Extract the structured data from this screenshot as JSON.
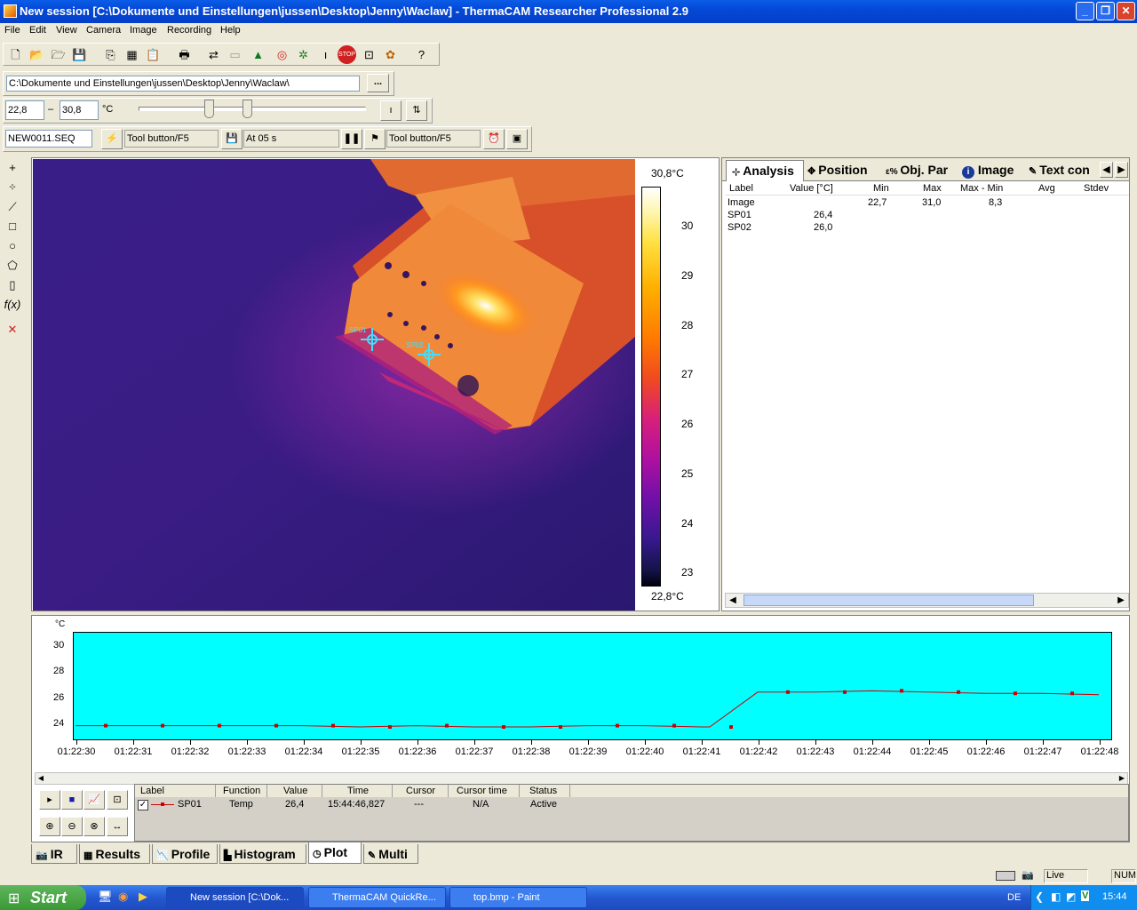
{
  "window": {
    "title": "New session [C:\\Dokumente und Einstellungen\\jussen\\Desktop\\Jenny\\Waclaw] - ThermaCAM Researcher Professional 2.9"
  },
  "menu": [
    "File",
    "Edit",
    "View",
    "Camera",
    "Image",
    "Recording",
    "Help"
  ],
  "path_field": "C:\\Dokumente und Einstellungen\\jussen\\Desktop\\Jenny\\Waclaw\\",
  "browse_label": "...",
  "range": {
    "min": "22,8",
    "dash": "–",
    "max": "30,8",
    "unit": "°C"
  },
  "seq_row": {
    "file": "NEW0011.SEQ",
    "tool1": "Tool button/F5",
    "at": "At 05 s",
    "tool2": "Tool button/F5"
  },
  "ir": {
    "spot_labels": [
      "SP01",
      "SP02"
    ],
    "scale_top": "30,8°C",
    "scale_bottom": "22,8°C",
    "scale_ticks": [
      "30",
      "29",
      "28",
      "27",
      "26",
      "25",
      "24",
      "23"
    ]
  },
  "analysis": {
    "tabs": [
      "Analysis",
      "Position",
      "Obj. Par",
      "Image",
      "Text con"
    ],
    "columns": [
      "Label",
      "Value [°C]",
      "Min",
      "Max",
      "Max - Min",
      "Avg",
      "Stdev"
    ],
    "rows": [
      {
        "label": "Image",
        "value": "",
        "min": "22,7",
        "max": "31,0",
        "maxmin": "8,3"
      },
      {
        "label": "SP01",
        "value": "26,4",
        "min": "",
        "max": "",
        "maxmin": ""
      },
      {
        "label": "SP02",
        "value": "26,0",
        "min": "",
        "max": "",
        "maxmin": ""
      }
    ]
  },
  "plot": {
    "unit": "°C",
    "yticks": [
      "30",
      "28",
      "26",
      "24"
    ],
    "xticks": [
      "01:22:30",
      "01:22:31",
      "01:22:32",
      "01:22:33",
      "01:22:34",
      "01:22:35",
      "01:22:36",
      "01:22:37",
      "01:22:38",
      "01:22:39",
      "01:22:40",
      "01:22:41",
      "01:22:42",
      "01:22:43",
      "01:22:44",
      "01:22:45",
      "01:22:46",
      "01:22:47",
      "01:22:48"
    ],
    "columns": [
      "Label",
      "Function",
      "Value",
      "Time",
      "Cursor",
      "Cursor time",
      "Status"
    ],
    "row": {
      "label": "SP01",
      "function": "Temp",
      "value": "26,4",
      "time": "15:44:46,827",
      "cursor": "---",
      "cursor_time": "N/A",
      "status": "Active"
    },
    "bg_color": "#00ffff",
    "line_color": "#cc0000"
  },
  "chart_data": {
    "type": "line",
    "title": "",
    "xlabel": "",
    "ylabel": "°C",
    "ylim": [
      22.8,
      31.0
    ],
    "x": [
      "01:22:30",
      "01:22:31",
      "01:22:32",
      "01:22:33",
      "01:22:34",
      "01:22:35",
      "01:22:36",
      "01:22:37",
      "01:22:38",
      "01:22:39",
      "01:22:40",
      "01:22:41",
      "01:22:42",
      "01:22:43",
      "01:22:44",
      "01:22:45",
      "01:22:46",
      "01:22:47",
      "01:22:48"
    ],
    "series": [
      {
        "name": "SP01",
        "values": [
          24.0,
          24.0,
          24.0,
          24.0,
          24.0,
          23.9,
          24.0,
          23.9,
          23.9,
          24.0,
          24.0,
          23.9,
          26.6,
          26.6,
          26.7,
          26.6,
          26.5,
          26.5,
          26.4
        ]
      }
    ]
  },
  "bottom_tabs": [
    "IR",
    "Results",
    "Profile",
    "Histogram",
    "Plot",
    "Multi"
  ],
  "status": {
    "live": "Live",
    "num": "NUM"
  },
  "taskbar": {
    "start": "Start",
    "tasks": [
      "New session [C:\\Dok...",
      "ThermaCAM QuickRe...",
      "top.bmp - Paint"
    ],
    "lang": "DE",
    "clock": "15:44"
  }
}
